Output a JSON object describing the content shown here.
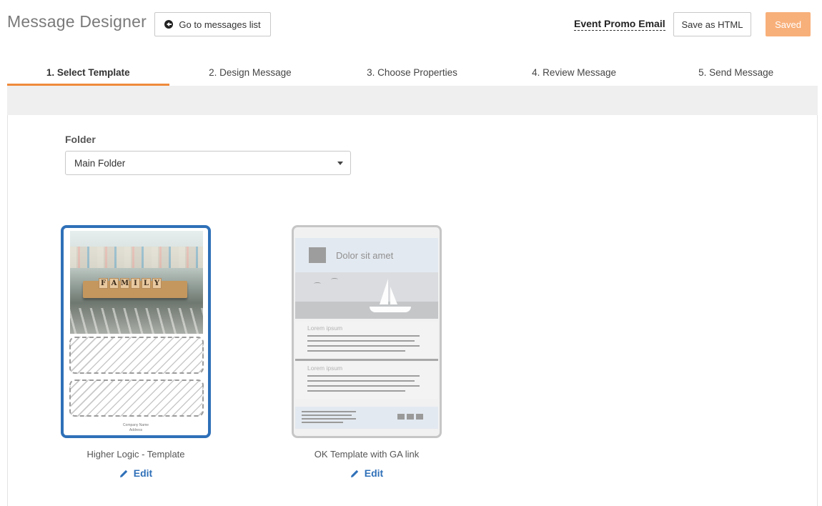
{
  "header": {
    "title": "Message Designer",
    "back_button": "Go to messages list",
    "message_name": "Event Promo Email",
    "save_html_button": "Save as HTML",
    "saved_button": "Saved",
    "accent_color": "#ef8a3b",
    "saved_color": "#f8b07a"
  },
  "steps": [
    {
      "label": "1. Select Template",
      "active": true
    },
    {
      "label": "2. Design Message",
      "active": false
    },
    {
      "label": "3. Choose Properties",
      "active": false
    },
    {
      "label": "4. Review Message",
      "active": false
    },
    {
      "label": "5. Send Message",
      "active": false
    }
  ],
  "folder": {
    "label": "Folder",
    "selected": "Main Folder"
  },
  "templates": [
    {
      "name": "Higher Logic - Template",
      "edit_label": "Edit",
      "selected": true,
      "thumbnail": {
        "tiles": [
          "F",
          "A",
          "M",
          "I",
          "L",
          "Y"
        ],
        "footer_line1": "Company Name",
        "footer_line2": "Address"
      }
    },
    {
      "name": "OK Template with GA link",
      "edit_label": "Edit",
      "selected": false,
      "thumbnail": {
        "heading": "Dolor sit amet",
        "section1_label": "Lorem ipsum",
        "section2_label": "Lorem ipsum"
      }
    }
  ],
  "selection_color": "#2f70b8"
}
